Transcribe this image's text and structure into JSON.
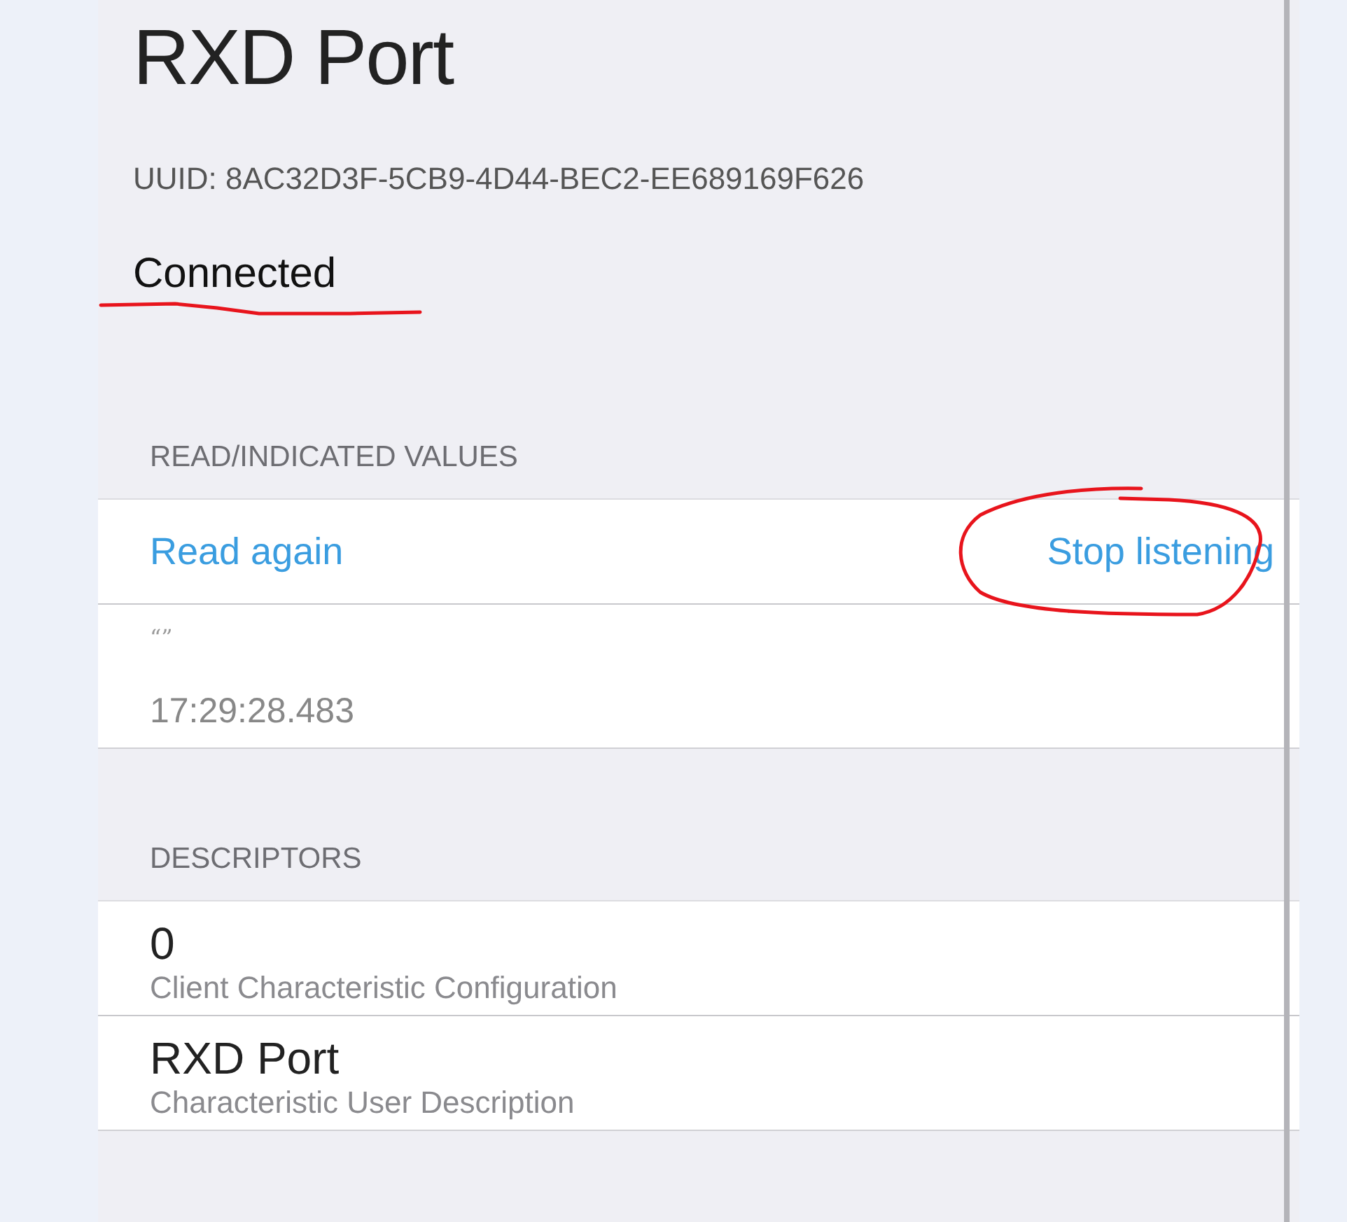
{
  "title": "RXD Port",
  "uuid": "UUID: 8AC32D3F-5CB9-4D44-BEC2-EE689169F626",
  "status": "Connected",
  "sections": [
    {
      "kind": "values",
      "header": "READ/INDICATED VALUES",
      "actions": [
        "Read again",
        "Stop listening"
      ],
      "value": "“”",
      "timestamp": "17:29:28.483"
    },
    {
      "kind": "descriptors",
      "header": "DESCRIPTORS",
      "items": [
        {
          "value": "0",
          "description": "Client Characteristic Configuration"
        },
        {
          "value": "RXD Port",
          "description": "Characteristic User Description"
        }
      ]
    }
  ]
}
